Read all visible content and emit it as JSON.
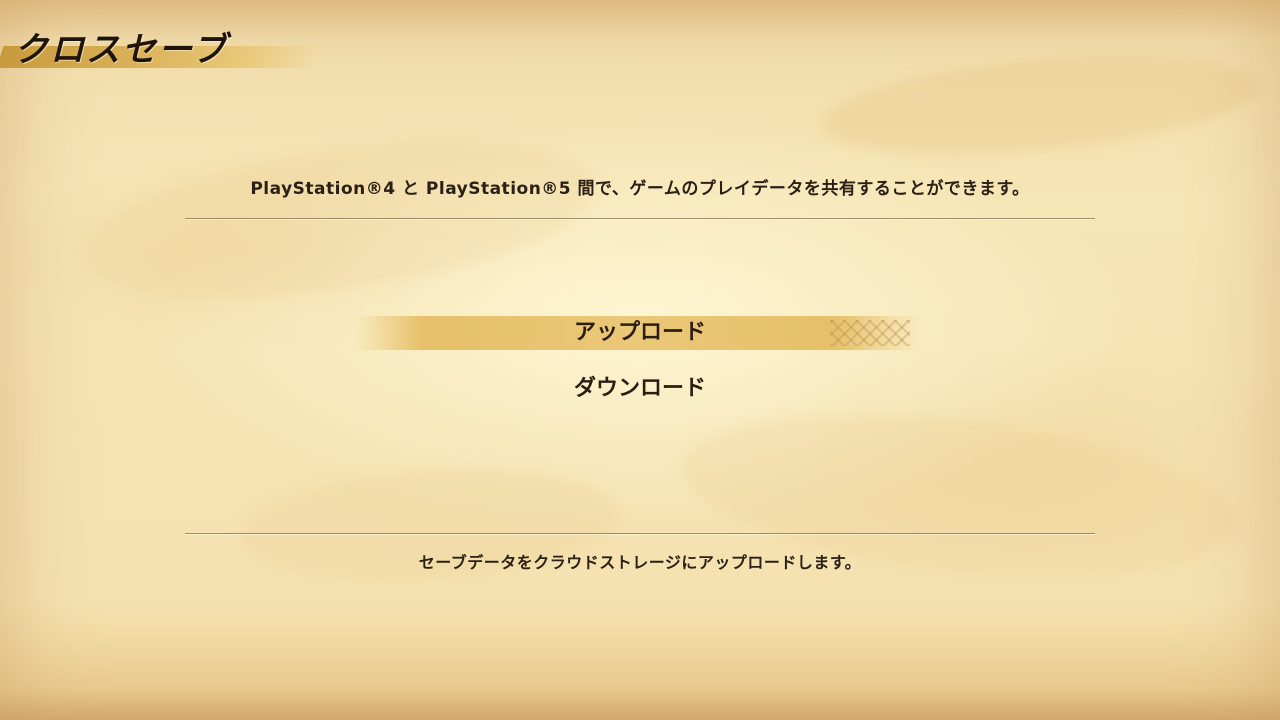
{
  "screen": {
    "title": "クロスセーブ",
    "description": "PlayStation®4 と PlayStation®5 間で、ゲームのプレイデータを共有することができます。",
    "help_text": "セーブデータをクラウドストレージにアップロードします。"
  },
  "menu": {
    "selected_index": 0,
    "items": [
      {
        "label": "アップロード"
      },
      {
        "label": "ダウンロード"
      }
    ]
  },
  "colors": {
    "parchment": "#f5e2b0",
    "highlight": "#ebc878",
    "text": "#2a1e12",
    "title_stripe": "#d9b057"
  }
}
